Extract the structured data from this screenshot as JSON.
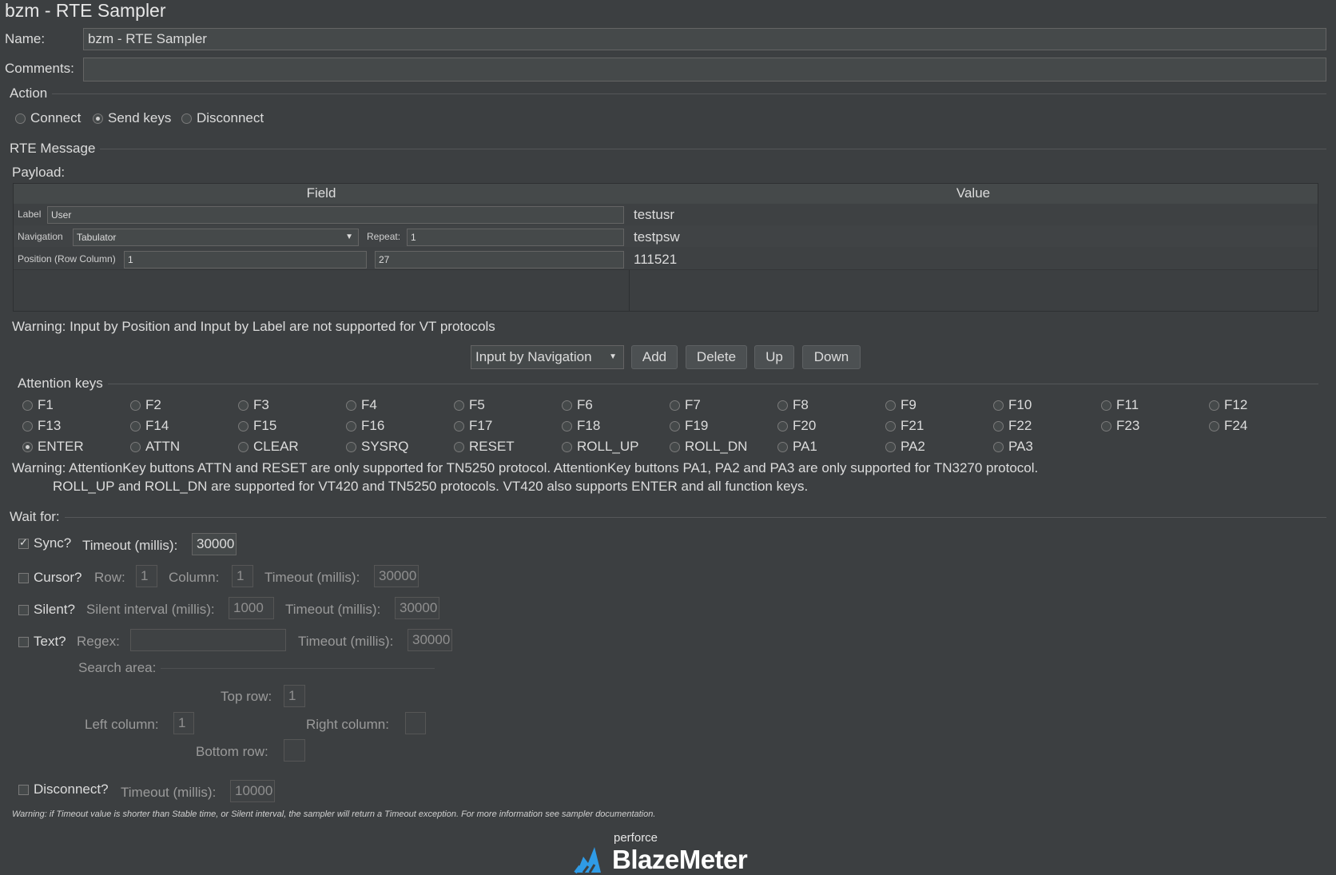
{
  "window": {
    "title": "bzm - RTE Sampler"
  },
  "name": {
    "label": "Name:",
    "value": "bzm - RTE Sampler"
  },
  "comments": {
    "label": "Comments:",
    "value": ""
  },
  "action": {
    "title": "Action",
    "options": [
      {
        "label": "Connect",
        "selected": false
      },
      {
        "label": "Send keys",
        "selected": true
      },
      {
        "label": "Disconnect",
        "selected": false
      }
    ]
  },
  "rte_message": {
    "title": "RTE Message",
    "payload_label": "Payload:",
    "columns": {
      "field": "Field",
      "value": "Value"
    },
    "rows": [
      {
        "field_label": "Label",
        "field_value": "User",
        "value": "testusr"
      },
      {
        "field_label": "Navigation",
        "nav_type": "Tabulator",
        "repeat_label": "Repeat:",
        "repeat_value": "1",
        "value": "testpsw"
      },
      {
        "field_label": "Position (Row Column)",
        "row_value": "1",
        "column_value": "27",
        "value": "111521"
      }
    ],
    "warning": "Warning: Input by Position and Input by Label are not supported for VT protocols",
    "input_mode": "Input by Navigation",
    "buttons": {
      "add": "Add",
      "delete": "Delete",
      "up": "Up",
      "down": "Down"
    }
  },
  "attention_keys": {
    "title": "Attention keys",
    "rows": [
      [
        "F1",
        "F2",
        "F3",
        "F4",
        "F5",
        "F6",
        "F7",
        "F8",
        "F9",
        "F10",
        "F11",
        "F12"
      ],
      [
        "F13",
        "F14",
        "F15",
        "F16",
        "F17",
        "F18",
        "F19",
        "F20",
        "F21",
        "F22",
        "F23",
        "F24"
      ],
      [
        "ENTER",
        "ATTN",
        "CLEAR",
        "SYSRQ",
        "RESET",
        "ROLL_UP",
        "ROLL_DN",
        "PA1",
        "PA2",
        "PA3"
      ]
    ],
    "selected": "ENTER",
    "warning_line1": "Warning: AttentionKey buttons ATTN and RESET are only supported for TN5250 protocol. AttentionKey buttons PA1, PA2 and PA3 are only supported for TN3270 protocol.",
    "warning_line2": "ROLL_UP and ROLL_DN are supported for VT420 and TN5250 protocols. VT420 also supports ENTER and all function keys."
  },
  "wait_for": {
    "title": "Wait for:",
    "sync": {
      "label": "Sync?",
      "checked": true,
      "timeout_label": "Timeout (millis):",
      "timeout": "30000"
    },
    "cursor": {
      "label": "Cursor?",
      "checked": false,
      "row_label": "Row:",
      "row": "1",
      "column_label": "Column:",
      "column": "1",
      "timeout_label": "Timeout (millis):",
      "timeout": "30000"
    },
    "silent": {
      "label": "Silent?",
      "checked": false,
      "interval_label": "Silent interval (millis):",
      "interval": "1000",
      "timeout_label": "Timeout (millis):",
      "timeout": "30000"
    },
    "text": {
      "label": "Text?",
      "checked": false,
      "regex_label": "Regex:",
      "regex": "",
      "timeout_label": "Timeout (millis):",
      "timeout": "30000"
    },
    "search_area": {
      "title": "Search area:",
      "top_row_label": "Top row:",
      "top_row": "1",
      "left_column_label": "Left column:",
      "left_column": "1",
      "right_column_label": "Right column:",
      "right_column": "",
      "bottom_row_label": "Bottom row:",
      "bottom_row": ""
    },
    "disconnect": {
      "label": "Disconnect?",
      "checked": false,
      "timeout_label": "Timeout (millis):",
      "timeout": "10000"
    }
  },
  "footer_warning": "Warning: if Timeout value is shorter than Stable time, or Silent interval, the sampler will return a Timeout exception. For more information see sampler documentation.",
  "brand": {
    "small": "perforce",
    "name": "BlazeMeter"
  },
  "colors": {
    "background": "#3c3f41",
    "field": "#45494a",
    "text": "#dcdcdc",
    "logo_accent": "#2f9be6"
  }
}
